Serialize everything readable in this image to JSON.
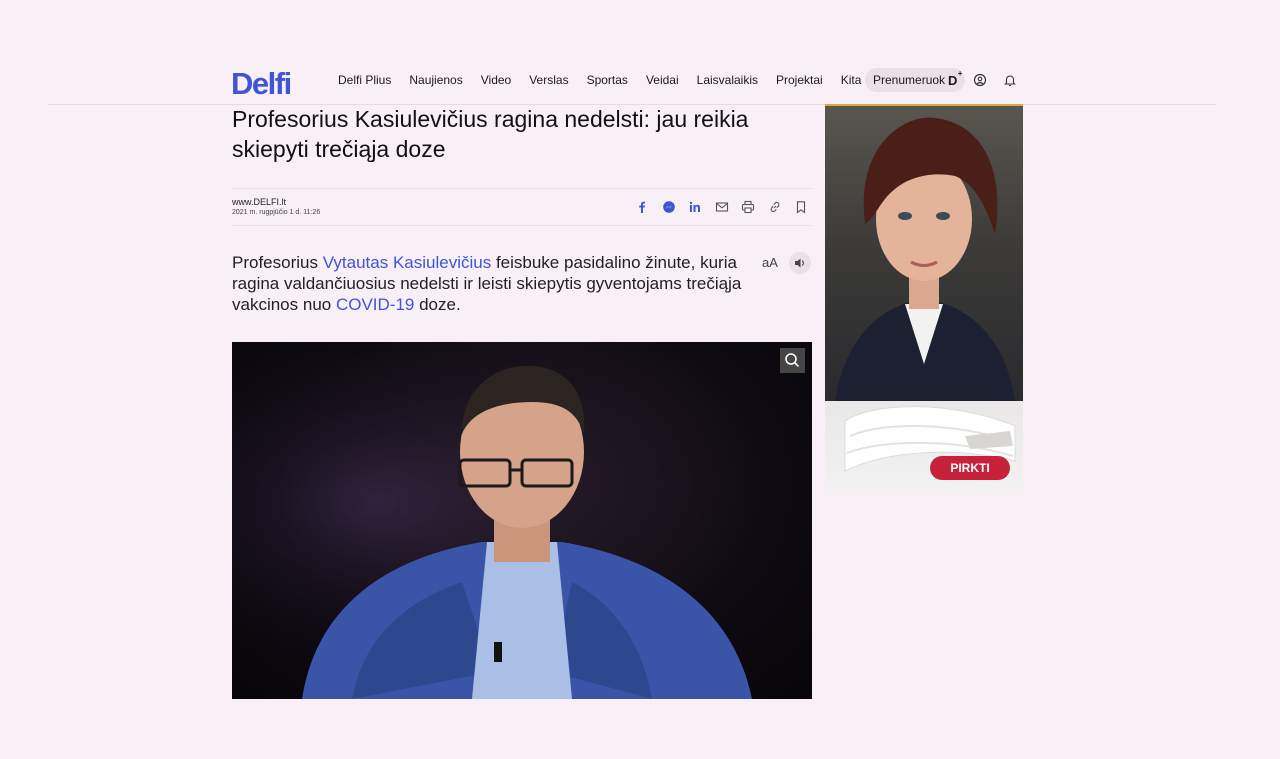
{
  "header": {
    "logo": "Delfi",
    "nav": [
      "Delfi Plius",
      "Naujienos",
      "Video",
      "Verslas",
      "Sportas",
      "Veidai",
      "Laisvalaikis",
      "Projektai",
      "Kita"
    ],
    "subscribe_label": "Prenumeruok",
    "subscribe_badge": "D",
    "subscribe_badge_plus": "+",
    "brand_color": "#3e55d6"
  },
  "article": {
    "title": "Profesorius Kasiulevičius ragina nedelsti: jau reikia skiepyti trečiąja doze",
    "source": "www.DELFI.lt",
    "date": "2021 m. rugpjūčio 1 d. 11:26",
    "share_icons": [
      "facebook-icon",
      "messenger-icon",
      "linkedin-icon",
      "email-icon",
      "print-icon",
      "link-icon",
      "bookmark-icon"
    ],
    "lead_part1": "Profesorius ",
    "lead_link1": "Vytautas Kasiulevičius",
    "lead_part2": " feisbuke pasidalino žinute, kuria ragina valdančiuosius nedelsti ir leisti skiepytis gyventojams trečiąja vakcinos nuo ",
    "lead_link2": "COVID-19",
    "lead_part3": " doze.",
    "text_size_label": "aA"
  },
  "ad": {
    "button_label": "PIRKTI",
    "button_color": "#c8223a"
  }
}
